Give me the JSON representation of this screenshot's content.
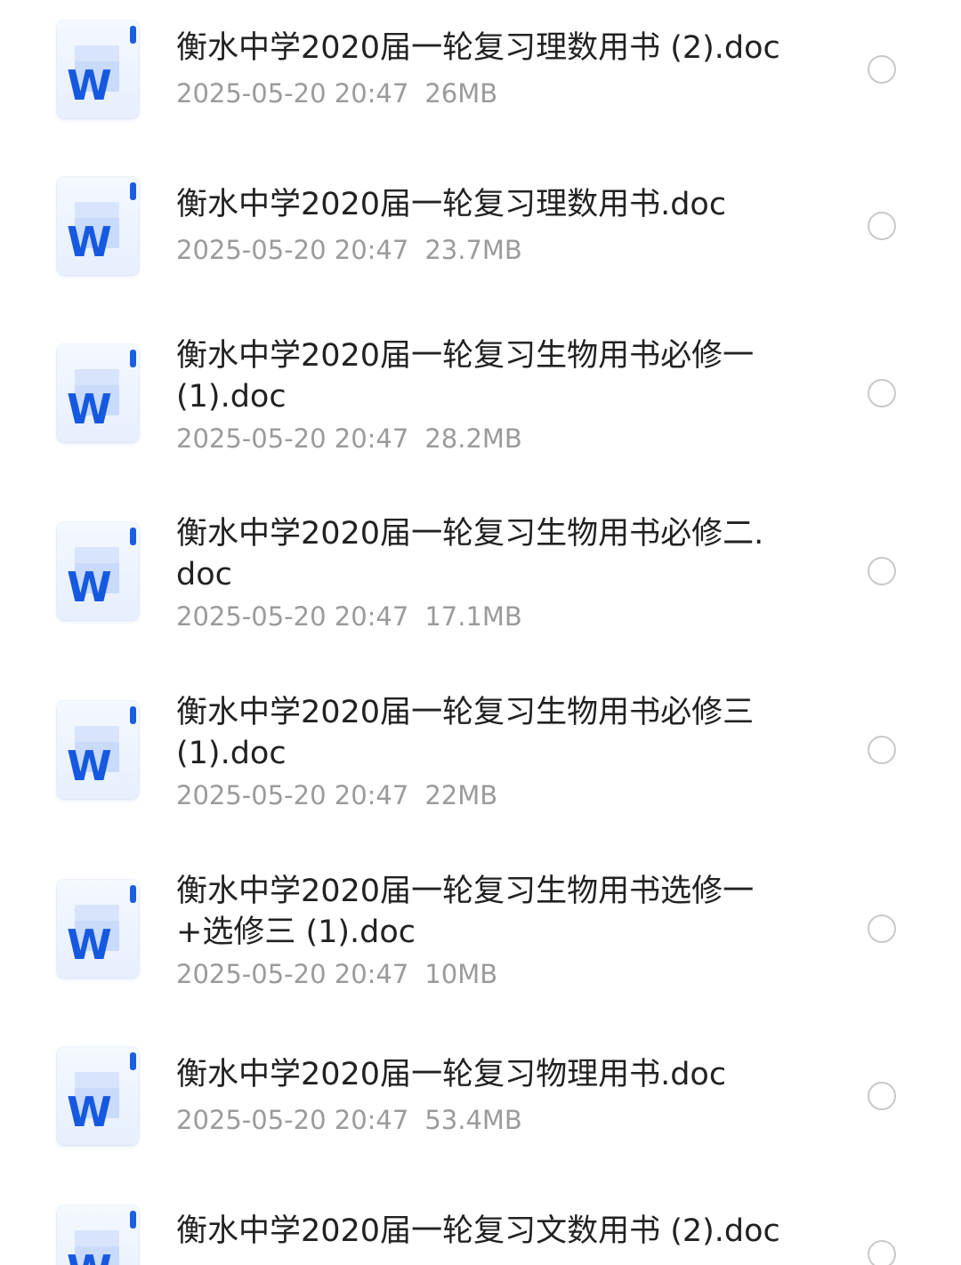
{
  "files": [
    {
      "name": "衡水中学2020届一轮复习理数用书 (2).doc",
      "date": "2025-05-20 20:47",
      "size": "26MB",
      "selected": false,
      "icon": "word-doc-icon"
    },
    {
      "name": "衡水中学2020届一轮复习理数用书.doc",
      "date": "2025-05-20 20:47",
      "size": "23.7MB",
      "selected": false,
      "icon": "word-doc-icon"
    },
    {
      "name": "衡水中学2020届一轮复习生物用书必修一\n(1).doc",
      "date": "2025-05-20 20:47",
      "size": "28.2MB",
      "selected": false,
      "icon": "word-doc-icon"
    },
    {
      "name": "衡水中学2020届一轮复习生物用书必修二.\ndoc",
      "date": "2025-05-20 20:47",
      "size": "17.1MB",
      "selected": false,
      "icon": "word-doc-icon"
    },
    {
      "name": "衡水中学2020届一轮复习生物用书必修三\n(1).doc",
      "date": "2025-05-20 20:47",
      "size": "22MB",
      "selected": false,
      "icon": "word-doc-icon"
    },
    {
      "name": "衡水中学2020届一轮复习生物用书选修一\n+选修三 (1).doc",
      "date": "2025-05-20 20:47",
      "size": "10MB",
      "selected": false,
      "icon": "word-doc-icon"
    },
    {
      "name": "衡水中学2020届一轮复习物理用书.doc",
      "date": "2025-05-20 20:47",
      "size": "53.4MB",
      "selected": false,
      "icon": "word-doc-icon"
    },
    {
      "name": "衡水中学2020届一轮复习文数用书 (2).doc",
      "date": "",
      "size": "",
      "selected": false,
      "icon": "word-doc-icon"
    }
  ],
  "colors": {
    "icon_letter": "#1559e0",
    "name_text": "#222222",
    "meta_text": "#9b9b9b",
    "radio_border": "#c9c9c9"
  }
}
